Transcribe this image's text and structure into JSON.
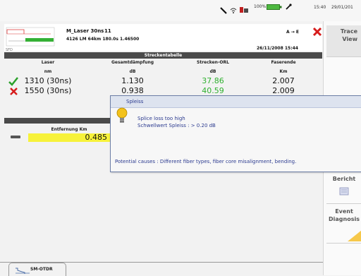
{
  "statusbar": {
    "battery": "100%",
    "time": "15:40",
    "date": "29/01/201"
  },
  "info": {
    "title": "M_Laser 30ns",
    "index": "11",
    "details": "4126 LM 64km 180.0s 1.46500",
    "direction": "A → E",
    "datetime": "26/11/2008  15:44",
    "pane_label": "SFD"
  },
  "side": {
    "trace_view": "Trace View",
    "bericht": "Bericht",
    "event_diagnosis": "Event Diagnosis"
  },
  "results": {
    "section_title": "Streckentabelle",
    "columns": [
      {
        "name": "Laser",
        "unit": "nm"
      },
      {
        "name": "Gesamtdämpfung",
        "unit": "dB"
      },
      {
        "name": "Strecken-ORL",
        "unit": "dB"
      },
      {
        "name": "Faserende",
        "unit": "Km"
      }
    ],
    "rows": [
      {
        "status": "pass",
        "laser": "1310 (30ns)",
        "loss": "1.130",
        "orl": "37.86",
        "end": "2.007"
      },
      {
        "status": "fail",
        "laser": "1550 (30ns)",
        "loss": "0.938",
        "orl": "40.59",
        "end": "2.009"
      }
    ]
  },
  "marker": {
    "header": "Entfernung Km",
    "value": "0.485"
  },
  "popup": {
    "title": "Spleiss",
    "message": "Splice loss too high",
    "threshold": "Schwellwert Spleiss : > 0.20 dB",
    "causes": "Potential causes : Different fiber types, fiber core misalignment, bending."
  },
  "tab": {
    "label": "SM-OTDR"
  },
  "colors": {
    "orl_green": "#2fb02f",
    "marker_yellow": "#f7f23a",
    "fail_red": "#d61c1c"
  }
}
